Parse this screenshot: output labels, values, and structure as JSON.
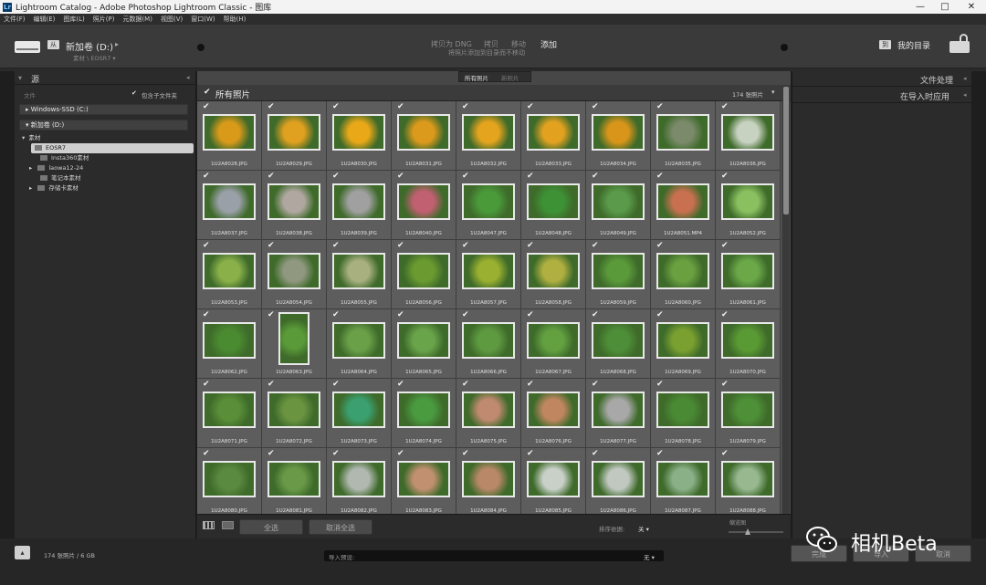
{
  "window": {
    "title": "Lightroom Catalog - Adobe Photoshop Lightroom Classic - 图库",
    "minimize": "—",
    "restore": "□",
    "close": "✕"
  },
  "menu": [
    "文件(F)",
    "编辑(E)",
    "图库(L)",
    "照片(P)",
    "元数据(M)",
    "视图(V)",
    "窗口(W)",
    "帮助(H)"
  ],
  "source": {
    "drive": "新加卷 (D:)",
    "path": "素材 \\ EOSR7 ▾"
  },
  "import_modes": {
    "copy_dng": "拷贝为 DNG",
    "copy": "拷贝",
    "move": "移动",
    "add": "添加",
    "description": "将照片添加到目录而不移动"
  },
  "destination": "我的目录",
  "left_panel": {
    "header": "源",
    "file_label": "文件",
    "include_subfolders": "包含子文件夹",
    "drives": [
      "Windows-SSD (C:)",
      "新加卷 (D:)"
    ],
    "tree": [
      "素材",
      "EOSR7",
      "Insta360素材",
      "laowa12-24",
      "笔记本素材",
      "存储卡素材"
    ]
  },
  "center": {
    "tabs": [
      "所有照片",
      "新照片"
    ],
    "all_photos_title": "所有照片",
    "photo_count": "174 张照片",
    "photos": [
      "1U2A8028.JPG",
      "1U2A8029.JPG",
      "1U2A8030.JPG",
      "1U2A8031.JPG",
      "1U2A8032.JPG",
      "1U2A8033.JPG",
      "1U2A8034.JPG",
      "1U2A8035.JPG",
      "1U2A8036.JPG",
      "1U2A8037.JPG",
      "1U2A8038.JPG",
      "1U2A8039.JPG",
      "1U2A8040.JPG",
      "1U2A8047.JPG",
      "1U2A8048.JPG",
      "1U2A8049.JPG",
      "1U2A8051.MP4",
      "1U2A8052.JPG",
      "1U2A8053.JPG",
      "1U2A8054.JPG",
      "1U2A8055.JPG",
      "1U2A8056.JPG",
      "1U2A8057.JPG",
      "1U2A8058.JPG",
      "1U2A8059.JPG",
      "1U2A8060.JPG",
      "1U2A8061.JPG",
      "1U2A8062.JPG",
      "1U2A8063.JPG",
      "1U2A8064.JPG",
      "1U2A8065.JPG",
      "1U2A8066.JPG",
      "1U2A8067.JPG",
      "1U2A8068.JPG",
      "1U2A8069.JPG",
      "1U2A8070.JPG",
      "1U2A8071.JPG",
      "1U2A8072.JPG",
      "1U2A8073.JPG",
      "1U2A8074.JPG",
      "1U2A8075.JPG",
      "1U2A8076.JPG",
      "1U2A8077.JPG",
      "1U2A8078.JPG",
      "1U2A8079.JPG",
      "1U2A8080.JPG",
      "1U2A8081.JPG",
      "1U2A8082.JPG",
      "1U2A8083.JPG",
      "1U2A8084.JPG",
      "1U2A8085.JPG",
      "1U2A8086.JPG",
      "1U2A8087.JPG",
      "1U2A8088.JPG"
    ],
    "thumb_colors": [
      "#d99a1a",
      "#e0a020",
      "#e8a818",
      "#dc9a1c",
      "#e4a41e",
      "#e2a220",
      "#d8951a",
      "#7a8a6a",
      "#c8d2c0",
      "#9aa0a8",
      "#b0a8a0",
      "#a0a0a0",
      "#c06070",
      "#4a9a3a",
      "#3e9236",
      "#5a9a4a",
      "#c87050",
      "#8ac060",
      "#8ab04a",
      "#909880",
      "#a8b080",
      "#6a9a30",
      "#9ab030",
      "#b0b040",
      "#5a9a3a",
      "#6aa040",
      "#6aa848",
      "#4a8a30",
      "#5a9a38",
      "#6aa048",
      "#6aa44a",
      "#5e9a40",
      "#62a040",
      "#4e8e38",
      "#7aa030",
      "#5a9a34",
      "#5a8e38",
      "#6a9440",
      "#3aa070",
      "#4a9a40",
      "#c08a70",
      "#c08660",
      "#a8a8a8",
      "#4a8a34",
      "#4e9038",
      "#5a8a40",
      "#6a9a48",
      "#b0b8b0",
      "#c09070",
      "#b88868",
      "#c8d0c8",
      "#c0c8c0",
      "#8ab088",
      "#98b890"
    ],
    "select_all": "全选",
    "deselect_all": "取消全选",
    "sort_label": "排序依据:",
    "sort_value": "关 ▾",
    "thumb_label": "缩览图"
  },
  "right_panel": {
    "file_handling": "文件处理",
    "apply_during_import": "在导入时应用"
  },
  "footer": {
    "summary": "174 张照片 / 6 GB",
    "preset_label": "导入预设:",
    "preset_value": "无 ▾",
    "done": "完成",
    "import": "导入",
    "cancel": "取消"
  },
  "watermark": "相机Beta"
}
